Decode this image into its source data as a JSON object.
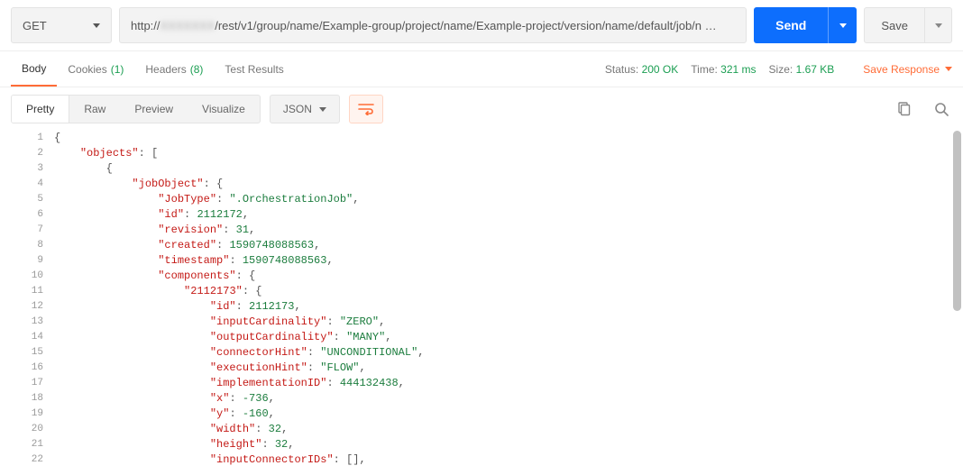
{
  "request": {
    "method": "GET",
    "url_prefix": "http://",
    "url_blurred": "XXXXXXX",
    "url_suffix": "/rest/v1/group/name/Example-group/project/name/Example-project/version/name/default/job/n …"
  },
  "actions": {
    "send_label": "Send",
    "save_label": "Save"
  },
  "response_tabs": {
    "body": "Body",
    "cookies": "Cookies",
    "cookies_count": "(1)",
    "headers": "Headers",
    "headers_count": "(8)",
    "test_results": "Test Results"
  },
  "status": {
    "status_label": "Status:",
    "status_value": "200 OK",
    "time_label": "Time:",
    "time_value": "321 ms",
    "size_label": "Size:",
    "size_value": "1.67 KB",
    "save_response": "Save Response"
  },
  "viewer": {
    "pretty": "Pretty",
    "raw": "Raw",
    "preview": "Preview",
    "visualize": "Visualize",
    "format": "JSON"
  },
  "code_lines": [
    {
      "n": 1,
      "indent": 0,
      "tokens": [
        {
          "t": "punc",
          "v": "{"
        }
      ]
    },
    {
      "n": 2,
      "indent": 1,
      "tokens": [
        {
          "t": "key",
          "v": "\"objects\""
        },
        {
          "t": "punc",
          "v": ": ["
        }
      ]
    },
    {
      "n": 3,
      "indent": 2,
      "tokens": [
        {
          "t": "punc",
          "v": "{"
        }
      ]
    },
    {
      "n": 4,
      "indent": 3,
      "tokens": [
        {
          "t": "key",
          "v": "\"jobObject\""
        },
        {
          "t": "punc",
          "v": ": {"
        }
      ]
    },
    {
      "n": 5,
      "indent": 4,
      "tokens": [
        {
          "t": "key",
          "v": "\"JobType\""
        },
        {
          "t": "punc",
          "v": ": "
        },
        {
          "t": "str",
          "v": "\".OrchestrationJob\""
        },
        {
          "t": "punc",
          "v": ","
        }
      ]
    },
    {
      "n": 6,
      "indent": 4,
      "tokens": [
        {
          "t": "key",
          "v": "\"id\""
        },
        {
          "t": "punc",
          "v": ": "
        },
        {
          "t": "num",
          "v": "2112172"
        },
        {
          "t": "punc",
          "v": ","
        }
      ]
    },
    {
      "n": 7,
      "indent": 4,
      "tokens": [
        {
          "t": "key",
          "v": "\"revision\""
        },
        {
          "t": "punc",
          "v": ": "
        },
        {
          "t": "num",
          "v": "31"
        },
        {
          "t": "punc",
          "v": ","
        }
      ]
    },
    {
      "n": 8,
      "indent": 4,
      "tokens": [
        {
          "t": "key",
          "v": "\"created\""
        },
        {
          "t": "punc",
          "v": ": "
        },
        {
          "t": "num",
          "v": "1590748088563"
        },
        {
          "t": "punc",
          "v": ","
        }
      ]
    },
    {
      "n": 9,
      "indent": 4,
      "tokens": [
        {
          "t": "key",
          "v": "\"timestamp\""
        },
        {
          "t": "punc",
          "v": ": "
        },
        {
          "t": "num",
          "v": "1590748088563"
        },
        {
          "t": "punc",
          "v": ","
        }
      ]
    },
    {
      "n": 10,
      "indent": 4,
      "tokens": [
        {
          "t": "key",
          "v": "\"components\""
        },
        {
          "t": "punc",
          "v": ": {"
        }
      ]
    },
    {
      "n": 11,
      "indent": 5,
      "tokens": [
        {
          "t": "key",
          "v": "\"2112173\""
        },
        {
          "t": "punc",
          "v": ": {"
        }
      ]
    },
    {
      "n": 12,
      "indent": 6,
      "tokens": [
        {
          "t": "key",
          "v": "\"id\""
        },
        {
          "t": "punc",
          "v": ": "
        },
        {
          "t": "num",
          "v": "2112173"
        },
        {
          "t": "punc",
          "v": ","
        }
      ]
    },
    {
      "n": 13,
      "indent": 6,
      "tokens": [
        {
          "t": "key",
          "v": "\"inputCardinality\""
        },
        {
          "t": "punc",
          "v": ": "
        },
        {
          "t": "str",
          "v": "\"ZERO\""
        },
        {
          "t": "punc",
          "v": ","
        }
      ]
    },
    {
      "n": 14,
      "indent": 6,
      "tokens": [
        {
          "t": "key",
          "v": "\"outputCardinality\""
        },
        {
          "t": "punc",
          "v": ": "
        },
        {
          "t": "str",
          "v": "\"MANY\""
        },
        {
          "t": "punc",
          "v": ","
        }
      ]
    },
    {
      "n": 15,
      "indent": 6,
      "tokens": [
        {
          "t": "key",
          "v": "\"connectorHint\""
        },
        {
          "t": "punc",
          "v": ": "
        },
        {
          "t": "str",
          "v": "\"UNCONDITIONAL\""
        },
        {
          "t": "punc",
          "v": ","
        }
      ]
    },
    {
      "n": 16,
      "indent": 6,
      "tokens": [
        {
          "t": "key",
          "v": "\"executionHint\""
        },
        {
          "t": "punc",
          "v": ": "
        },
        {
          "t": "str",
          "v": "\"FLOW\""
        },
        {
          "t": "punc",
          "v": ","
        }
      ]
    },
    {
      "n": 17,
      "indent": 6,
      "tokens": [
        {
          "t": "key",
          "v": "\"implementationID\""
        },
        {
          "t": "punc",
          "v": ": "
        },
        {
          "t": "num",
          "v": "444132438"
        },
        {
          "t": "punc",
          "v": ","
        }
      ]
    },
    {
      "n": 18,
      "indent": 6,
      "tokens": [
        {
          "t": "key",
          "v": "\"x\""
        },
        {
          "t": "punc",
          "v": ": "
        },
        {
          "t": "num",
          "v": "-736"
        },
        {
          "t": "punc",
          "v": ","
        }
      ]
    },
    {
      "n": 19,
      "indent": 6,
      "tokens": [
        {
          "t": "key",
          "v": "\"y\""
        },
        {
          "t": "punc",
          "v": ": "
        },
        {
          "t": "num",
          "v": "-160"
        },
        {
          "t": "punc",
          "v": ","
        }
      ]
    },
    {
      "n": 20,
      "indent": 6,
      "tokens": [
        {
          "t": "key",
          "v": "\"width\""
        },
        {
          "t": "punc",
          "v": ": "
        },
        {
          "t": "num",
          "v": "32"
        },
        {
          "t": "punc",
          "v": ","
        }
      ]
    },
    {
      "n": 21,
      "indent": 6,
      "tokens": [
        {
          "t": "key",
          "v": "\"height\""
        },
        {
          "t": "punc",
          "v": ": "
        },
        {
          "t": "num",
          "v": "32"
        },
        {
          "t": "punc",
          "v": ","
        }
      ]
    },
    {
      "n": 22,
      "indent": 6,
      "tokens": [
        {
          "t": "key",
          "v": "\"inputConnectorIDs\""
        },
        {
          "t": "punc",
          "v": ": [],"
        }
      ]
    }
  ]
}
